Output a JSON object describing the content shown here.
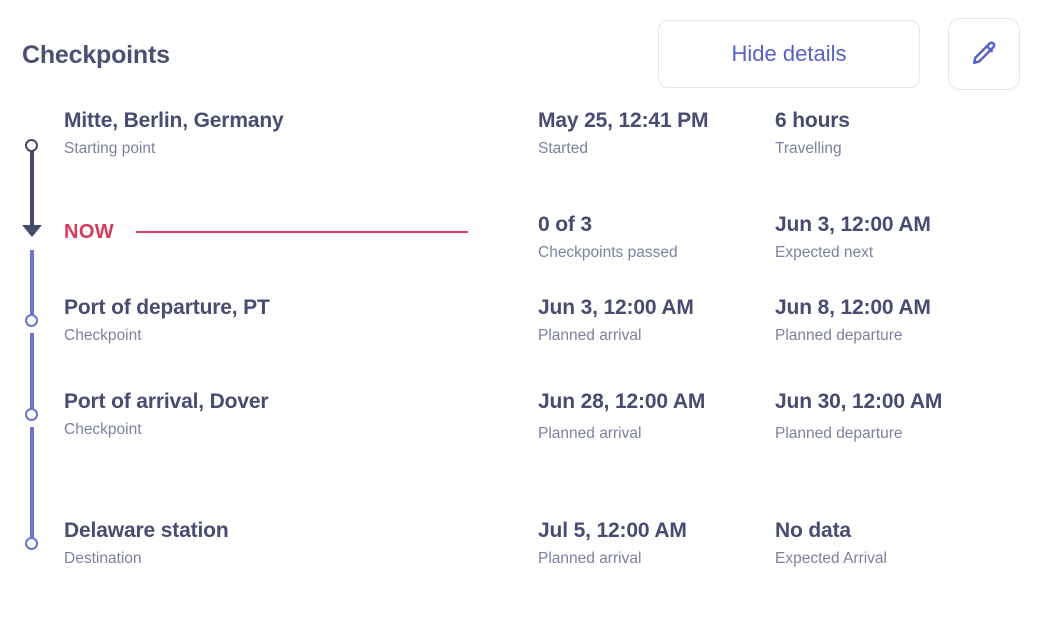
{
  "header": {
    "title": "Checkpoints",
    "hide_details_label": "Hide details",
    "edit_icon": "pencil-icon",
    "accent_color": "#5762c8",
    "title_color": "#4c5072",
    "border_color": "#e3e5ef"
  },
  "theme": {
    "primary_text": "#474c70",
    "secondary_text": "#7d81a1",
    "rail_done": "#454a6b",
    "rail_upcoming": "#6b74c8",
    "now_color": "#d93b5c"
  },
  "timeline": {
    "rows": [
      {
        "kind": "checkpoint",
        "marker": "circle-dark",
        "name": "Mitte, Berlin, Germany",
        "role": "Starting point",
        "mid_value": "May 25, 12:41 PM",
        "mid_label": "Started",
        "right_value": "6 hours",
        "right_label": "Travelling"
      },
      {
        "kind": "now",
        "marker": "arrow-down",
        "now_label": "NOW",
        "mid_value": "0 of 3",
        "mid_label": "Checkpoints passed",
        "right_value": "Jun 3, 12:00 AM",
        "right_label": "Expected next"
      },
      {
        "kind": "checkpoint",
        "marker": "circle-light",
        "name": "Port of departure, PT",
        "role": "Checkpoint",
        "mid_value": "Jun 3, 12:00 AM",
        "mid_label": "Planned arrival",
        "right_value": "Jun 8, 12:00 AM",
        "right_label": "Planned departure"
      },
      {
        "kind": "checkpoint",
        "marker": "circle-light",
        "name": "Port of arrival, Dover",
        "role": "Checkpoint",
        "mid_value": "Jun 28, 12:00 AM",
        "mid_label": "Planned arrival",
        "right_value": "Jun 30, 12:00 AM",
        "right_label": "Planned departure"
      },
      {
        "kind": "checkpoint",
        "marker": "circle-light",
        "name": "Delaware station",
        "role": "Destination",
        "mid_value": "Jul 5, 12:00 AM",
        "mid_label": "Planned arrival",
        "right_value": "No data",
        "right_label": "Expected Arrival"
      }
    ]
  }
}
